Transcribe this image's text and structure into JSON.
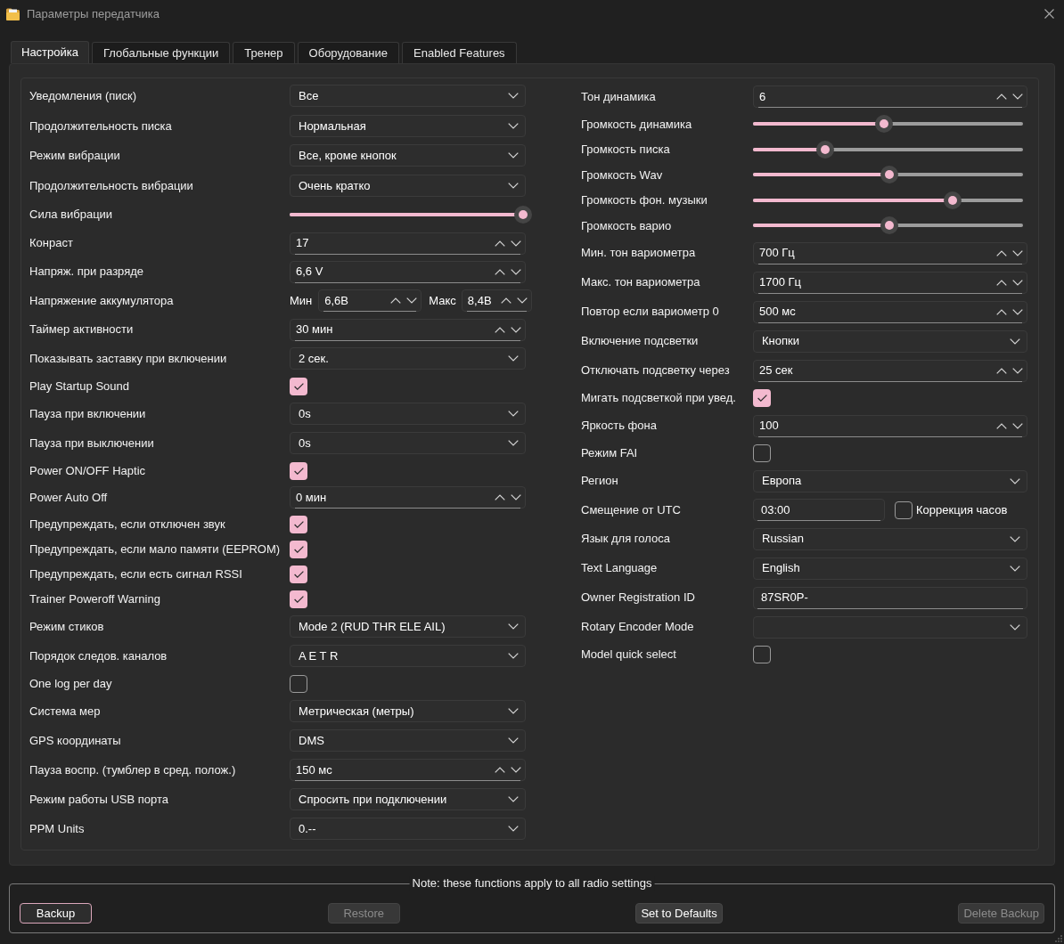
{
  "window": {
    "title": "Параметры передатчика"
  },
  "tabs": [
    {
      "label": "Настройка",
      "selected": true
    },
    {
      "label": "Глобальные функции",
      "selected": false
    },
    {
      "label": "Тренер",
      "selected": false
    },
    {
      "label": "Оборудование",
      "selected": false
    },
    {
      "label": "Enabled Features",
      "selected": false
    }
  ],
  "left_settings": [
    {
      "label": "Уведомления (писк)",
      "kind": "combo",
      "value": "Все"
    },
    {
      "label": "Продолжительность писка",
      "kind": "combo",
      "value": "Нормальная"
    },
    {
      "label": "Режим вибрации",
      "kind": "combo",
      "value": "Все, кроме кнопок"
    },
    {
      "label": "Продолжительность вибрации",
      "kind": "combo",
      "value": "Очень кратко"
    },
    {
      "label": "Сила вибрации",
      "kind": "slider",
      "level": 1.0
    },
    {
      "label": "Конраст",
      "kind": "spin",
      "value": "17"
    },
    {
      "label": "Напряж. при разряде",
      "kind": "spin",
      "value": "6,6 V"
    },
    {
      "label": "Напряжение аккумулятора",
      "kind": "minmax",
      "min_label": "Мин",
      "min_value": "6,6В",
      "max_label": "Макс",
      "max_value": "8,4В"
    },
    {
      "label": "Таймер активности",
      "kind": "spin",
      "value": "30 мин"
    },
    {
      "label": "Показывать заставку при включении",
      "kind": "combo",
      "value": "2 сек."
    },
    {
      "label": "Play Startup Sound",
      "kind": "checkbox",
      "checked": true
    },
    {
      "label": "Пауза при включении",
      "kind": "combo",
      "value": "0s"
    },
    {
      "label": "Пауза при выключении",
      "kind": "combo",
      "value": "0s"
    },
    {
      "label": "Power ON/OFF Haptic",
      "kind": "checkbox",
      "checked": true
    },
    {
      "label": "Power Auto Off",
      "kind": "spin",
      "value": "0 мин"
    },
    {
      "label": "Предупреждать, если отключен звук",
      "kind": "checkbox",
      "checked": true
    },
    {
      "label": "Предупреждать, если мало памяти (EEPROM)",
      "kind": "checkbox",
      "checked": true
    },
    {
      "label": "Предупреждать, если есть сигнал RSSI",
      "kind": "checkbox",
      "checked": true
    },
    {
      "label": "Trainer Poweroff Warning",
      "kind": "checkbox",
      "checked": true
    },
    {
      "label": "Режим стиков",
      "kind": "combo",
      "value": "Mode 2 (RUD THR ELE AIL)"
    },
    {
      "label": "Порядок следов. каналов",
      "kind": "combo",
      "value": "A E T R"
    },
    {
      "label": "One log per day",
      "kind": "checkbox",
      "checked": false
    },
    {
      "label": "Система мер",
      "kind": "combo",
      "value": "Метрическая (метры)"
    },
    {
      "label": "GPS координаты",
      "kind": "combo",
      "value": "DMS"
    },
    {
      "label": "Пауза воспр. (тумблер в сред. полож.)",
      "kind": "spin",
      "value": "150 мс"
    },
    {
      "label": "Режим работы USB порта",
      "kind": "combo",
      "value": "Спросить при подключении"
    },
    {
      "label": "PPM Units",
      "kind": "combo",
      "value": "0.--"
    }
  ],
  "right_settings": [
    {
      "label": "Тон динамика",
      "kind": "spin",
      "value": "6"
    },
    {
      "label": "Громкость динамика",
      "kind": "slider",
      "level": 0.48
    },
    {
      "label": "Громкость писка",
      "kind": "slider",
      "level": 0.25
    },
    {
      "label": "Громкость Wav",
      "kind": "slider",
      "level": 0.5
    },
    {
      "label": "Громкость фон. музыки",
      "kind": "slider",
      "level": 0.75
    },
    {
      "label": "Громкость варио",
      "kind": "slider",
      "level": 0.5
    },
    {
      "label": "Мин. тон вариометра",
      "kind": "spin",
      "value": "700 Гц"
    },
    {
      "label": "Макс. тон вариометра",
      "kind": "spin",
      "value": "1700 Гц"
    },
    {
      "label": "Повтор если вариометр 0",
      "kind": "spin",
      "value": "500 мс"
    },
    {
      "label": "Включение подсветки",
      "kind": "combo",
      "value": "Кнопки"
    },
    {
      "label": "Отключать подсветку через",
      "kind": "spin",
      "value": "25 сек"
    },
    {
      "label": "Мигать подсветкой при увед.",
      "kind": "checkbox",
      "checked": true
    },
    {
      "label": "Яркость фона",
      "kind": "spin",
      "value": "100"
    },
    {
      "label": "Режим FAI",
      "kind": "checkbox",
      "checked": false
    },
    {
      "label": "Регион",
      "kind": "combo",
      "value": "Европа"
    },
    {
      "label": "Смещение от UTC",
      "kind": "text_check",
      "value": "03:00",
      "check_label": "Коррекция часов",
      "checked": false
    },
    {
      "label": "Язык для голоса",
      "kind": "combo",
      "value": "Russian"
    },
    {
      "label": "Text Language",
      "kind": "combo",
      "value": "English"
    },
    {
      "label": "Owner Registration ID",
      "kind": "text",
      "value": "87SR0P-"
    },
    {
      "label": "Rotary Encoder Mode",
      "kind": "combo"
    },
    {
      "label": "Model quick select",
      "kind": "checkbox",
      "checked": false
    }
  ],
  "backup_group": {
    "title": "Note: these functions apply to all radio settings",
    "buttons": [
      {
        "label": "Backup",
        "disabled": false,
        "focused": true
      },
      {
        "label": "Restore",
        "disabled": true,
        "focused": false
      },
      {
        "label": "Set to Defaults",
        "disabled": false,
        "focused": false
      },
      {
        "label": "Delete Backup",
        "disabled": true,
        "focused": false
      }
    ]
  }
}
